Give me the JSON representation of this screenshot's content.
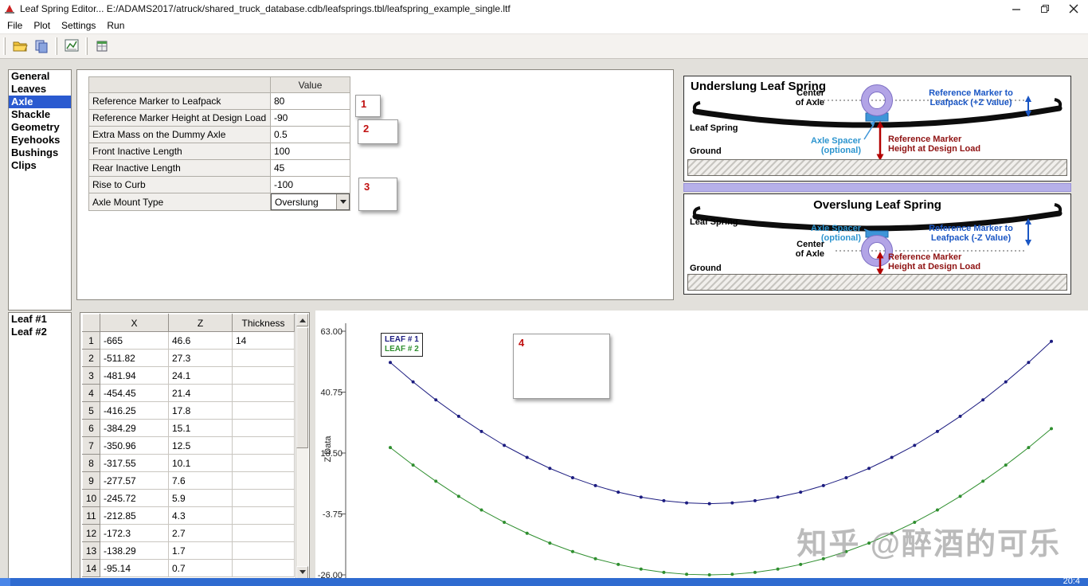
{
  "window": {
    "title": "Leaf Spring Editor... E:/ADAMS2017/atruck/shared_truck_database.cdb/leafsprings.tbl/leafspring_example_single.ltf"
  },
  "menu": {
    "items": [
      "File",
      "Plot",
      "Settings",
      "Run"
    ]
  },
  "toolbar": {
    "icons": [
      "open-file-icon",
      "save-icon",
      "plot-icon",
      "table-icon"
    ]
  },
  "sidebar": {
    "items": [
      "General",
      "Leaves",
      "Axle",
      "Shackle",
      "Geometry",
      "Eyehooks",
      "Bushings",
      "Clips"
    ],
    "selected": "Axle"
  },
  "properties": {
    "value_header": "Value",
    "rows": [
      {
        "label": "Reference Marker to Leafpack",
        "value": "80"
      },
      {
        "label": "Reference Marker Height at Design Load",
        "value": "-90"
      },
      {
        "label": "Extra Mass on the Dummy Axle",
        "value": "0.5"
      },
      {
        "label": "Front Inactive Length",
        "value": "100"
      },
      {
        "label": "Rear Inactive Length",
        "value": "45"
      },
      {
        "label": "Rise to Curb",
        "value": "-100"
      }
    ],
    "axle_mount_label": "Axle Mount Type",
    "axle_mount_value": "Overslung"
  },
  "callouts": [
    "1",
    "2",
    "3",
    "4"
  ],
  "diagrams": {
    "underslung": {
      "title": "Underslung Leaf Spring",
      "center_axle_1": "Center",
      "center_axle_2": "of Axle",
      "ref_leafpack_1": "Reference Marker to",
      "ref_leafpack_2": "Leafpack (+Z Value)",
      "leaf_spring": "Leaf Spring",
      "spacer_1": "Axle Spacer",
      "spacer_2": "(optional)",
      "ref_height_1": "Reference Marker",
      "ref_height_2": "Height at Design Load",
      "ground": "Ground"
    },
    "overslung": {
      "title": "Overslung Leaf Spring",
      "center_axle_1": "Center",
      "center_axle_2": "of Axle",
      "ref_leafpack_1": "Reference Marker to",
      "ref_leafpack_2": "Leafpack (-Z Value)",
      "leaf_spring": "Leaf Spring",
      "spacer_1": "Axle Spacer",
      "spacer_2": "(optional)",
      "ref_height_1": "Reference Marker",
      "ref_height_2": "Height at Design Load",
      "ground": "Ground"
    }
  },
  "leaves": {
    "items": [
      "Leaf #1",
      "Leaf #2"
    ]
  },
  "points_table": {
    "columns": [
      "X",
      "Z",
      "Thickness"
    ],
    "rows": [
      [
        "-665",
        "46.6",
        "14"
      ],
      [
        "-511.82",
        "27.3",
        ""
      ],
      [
        "-481.94",
        "24.1",
        ""
      ],
      [
        "-454.45",
        "21.4",
        ""
      ],
      [
        "-416.25",
        "17.8",
        ""
      ],
      [
        "-384.29",
        "15.1",
        ""
      ],
      [
        "-350.96",
        "12.5",
        ""
      ],
      [
        "-317.55",
        "10.1",
        ""
      ],
      [
        "-277.57",
        "7.6",
        ""
      ],
      [
        "-245.72",
        "5.9",
        ""
      ],
      [
        "-212.85",
        "4.3",
        ""
      ],
      [
        "-172.3",
        "2.7",
        ""
      ],
      [
        "-138.29",
        "1.7",
        ""
      ],
      [
        "-95.14",
        "0.7",
        ""
      ]
    ]
  },
  "chart_data": {
    "type": "line",
    "title": "",
    "xlabel": "",
    "ylabel": "Z Data",
    "ylim": [
      -26,
      63
    ],
    "xlim": [
      -700,
      750
    ],
    "yticks": [
      63.0,
      40.75,
      18.5,
      -3.75,
      -26.0
    ],
    "grid": false,
    "legend_position": "top-left",
    "series": [
      {
        "name": "LEAF # 1",
        "color": "#1c1c80",
        "x": [
          -700,
          -650,
          -600,
          -550,
          -500,
          -450,
          -400,
          -350,
          -300,
          -250,
          -200,
          -150,
          -100,
          -50,
          0,
          50,
          100,
          150,
          200,
          250,
          300,
          350,
          400,
          450,
          500,
          550,
          600,
          650,
          700,
          750
        ],
        "y": [
          51.6,
          44.5,
          37.9,
          31.9,
          26.4,
          21.3,
          16.9,
          12.9,
          9.5,
          6.6,
          4.2,
          2.4,
          1.1,
          0.3,
          0.0,
          0.3,
          1.1,
          2.4,
          4.2,
          6.6,
          9.5,
          12.9,
          16.9,
          21.3,
          26.4,
          31.9,
          37.9,
          44.5,
          51.6,
          59.3
        ]
      },
      {
        "name": "LEAF # 2",
        "color": "#2f8f2f",
        "x": [
          -700,
          -650,
          -600,
          -550,
          -500,
          -450,
          -400,
          -350,
          -300,
          -250,
          -200,
          -150,
          -100,
          -50,
          0,
          50,
          100,
          150,
          200,
          250,
          300,
          350,
          400,
          450,
          500,
          550,
          600,
          650,
          700,
          750
        ],
        "y": [
          20.5,
          14.1,
          8.2,
          2.7,
          -2.3,
          -6.8,
          -10.8,
          -14.4,
          -17.5,
          -20.1,
          -22.2,
          -23.9,
          -25.1,
          -25.8,
          -26.0,
          -25.8,
          -25.1,
          -23.9,
          -22.2,
          -20.1,
          -17.5,
          -14.4,
          -10.8,
          -6.8,
          -2.3,
          2.7,
          8.2,
          14.1,
          20.5,
          27.4
        ]
      }
    ]
  },
  "watermark": "知乎 @醉酒的可乐",
  "taskbar": {
    "time": "20:4"
  }
}
